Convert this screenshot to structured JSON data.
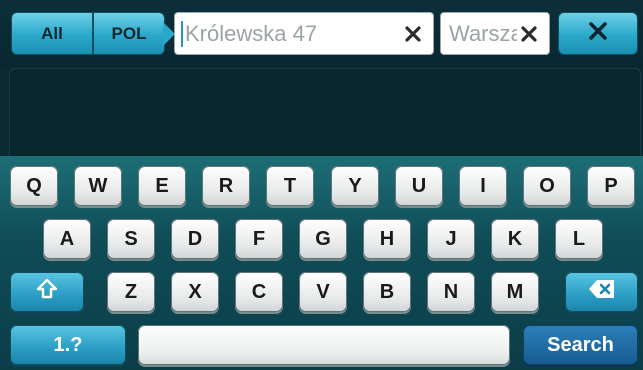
{
  "filters": {
    "all_label": "All",
    "country_label": "POL"
  },
  "search": {
    "street_value": "Królewska 47",
    "city_value": "Warsza"
  },
  "keyboard": {
    "row1": [
      "Q",
      "W",
      "E",
      "R",
      "T",
      "Y",
      "U",
      "I",
      "O",
      "P"
    ],
    "row2": [
      "A",
      "S",
      "D",
      "F",
      "G",
      "H",
      "J",
      "K",
      "L"
    ],
    "row3": [
      "Z",
      "X",
      "C",
      "V",
      "B",
      "N",
      "M"
    ],
    "numbers_label": "1.?",
    "search_label": "Search"
  },
  "colors": {
    "accent": "#2aa8c9",
    "search_key": "#1f6aa3",
    "background": "#0b2a33"
  },
  "icons": {
    "shift": "shift-icon",
    "backspace": "backspace-icon",
    "close": "close-icon",
    "clear": "clear-icon"
  }
}
